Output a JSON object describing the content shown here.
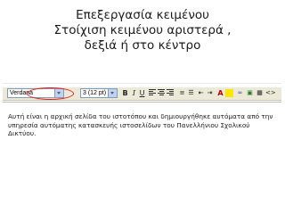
{
  "slide": {
    "title_lines": [
      "Επεξεργασία κειμένου",
      "Στοίχιση κειμένου αριστερά ,",
      "δεξιά ή στο κέντρο"
    ]
  },
  "toolbar": {
    "font_family_value": "Verdana",
    "font_size_value": "3 (12 pt)",
    "buttons": [
      "bold-icon",
      "italic-icon",
      "underline-icon",
      "align-left-icon",
      "align-center-icon",
      "align-right-icon",
      "ordered-list-icon",
      "unordered-list-icon",
      "outdent-icon",
      "indent-icon",
      "text-color-icon",
      "highlight-icon",
      "link-icon",
      "image-icon",
      "table-icon",
      "source-icon"
    ],
    "source_label": "<>"
  },
  "editor": {
    "content": "Αυτή είναι η αρχική σελίδα του ιστοτόπου και δημιουργήθηκε αυτόματα από την υπηρεσία αυτόματης κατασκευής ιστοσελίδων του Πανελλήνιου Σχολικού Δικτύου."
  },
  "colors": {
    "highlight": "#e02020",
    "toolbar_bg": "#ece9d8"
  }
}
